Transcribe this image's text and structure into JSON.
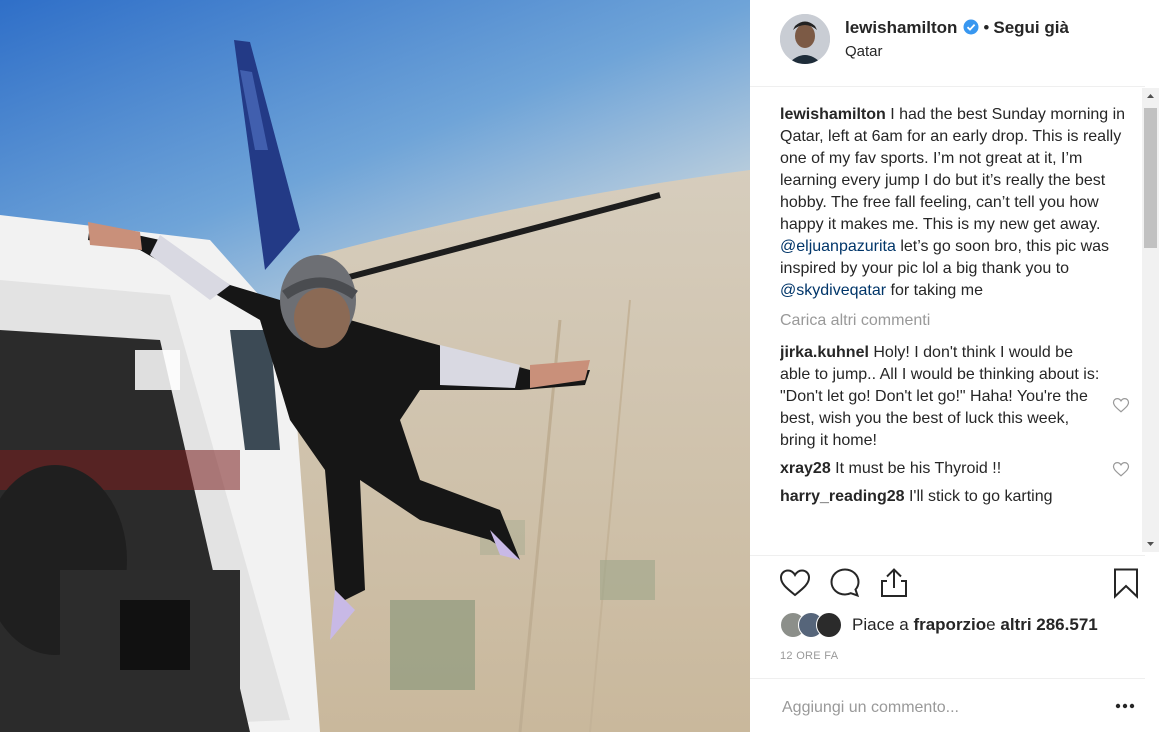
{
  "post": {
    "username": "lewishamilton",
    "separator": "•",
    "follow_label": "Segui già",
    "location": "Qatar"
  },
  "caption": {
    "user": "lewishamilton",
    "text1": " I had the best Sunday morning in Qatar, left at 6am for an early drop. This is really one of my fav sports. I’m not great at it, I’m learning every jump I do but it’s really the best hobby. The free fall feeling, can’t tell you how happy it makes me. This is my new get away. ",
    "mention1": "@eljuanpazurita",
    "text2": " let’s go soon bro, this pic was inspired by your pic lol a big thank you to ",
    "mention2": "@skydiveqatar",
    "text3": " for taking me"
  },
  "load_more": "Carica altri commenti",
  "comments": [
    {
      "user": "jirka.kuhnel",
      "text": " Holy! I don't think I would be able to jump.. All I would be thinking about is: \"Don't let go! Don't let go!\" Haha! You're the best, wish you the best of luck this week, bring it home!"
    },
    {
      "user": "xray28",
      "text": " It must be his Thyroid !!"
    },
    {
      "user": "harry_reading28",
      "text": " I'll stick to go karting"
    }
  ],
  "likes": {
    "prefix": "Piace a ",
    "user": "fraporzio",
    "middle": " e ",
    "count": "altri 286.571"
  },
  "time": "12 ORE FA",
  "add_comment_placeholder": "Aggiungi un commento...",
  "icons": [
    "verified-badge-icon",
    "heart-icon",
    "comment-icon",
    "share-icon",
    "bookmark-icon",
    "more-options-icon"
  ],
  "colors": {
    "verified": "#3897f0",
    "mention": "#003569",
    "muted": "#999999",
    "sky": "#3d7bc8"
  }
}
